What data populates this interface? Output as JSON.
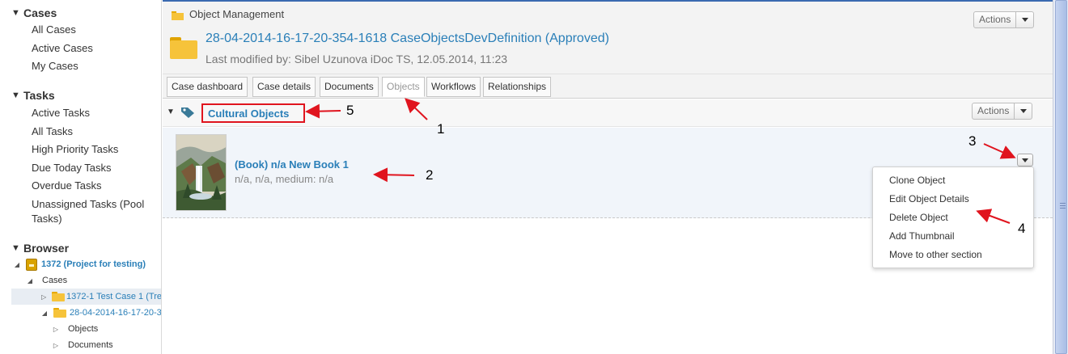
{
  "sidebar": {
    "cases": {
      "title": "Cases",
      "items": [
        "All Cases",
        "Active Cases",
        "My Cases"
      ]
    },
    "tasks": {
      "title": "Tasks",
      "items": [
        "Active Tasks",
        "All Tasks",
        "High Priority Tasks",
        "Due Today Tasks",
        "Overdue Tasks",
        "Unassigned Tasks (Pool Tasks)"
      ]
    },
    "browser": {
      "title": "Browser",
      "project": "1372 (Project for testing)",
      "cases_label": "Cases",
      "case1": "1372-1 Test Case 1 (Tre",
      "case2": "28-04-2014-16-17-20-3",
      "objects": "Objects",
      "documents": "Documents"
    }
  },
  "header": {
    "module": "Object Management",
    "title": "28-04-2014-16-17-20-354-1618 CaseObjectsDevDefinition (Approved)",
    "meta": "Last modified by: Sibel Uzunova iDoc TS, 12.05.2014, 11:23",
    "actions_label": "Actions"
  },
  "tabs": [
    "Case dashboard",
    "Case details",
    "Documents",
    "Objects",
    "Workflows",
    "Relationships"
  ],
  "active_tab": "Objects",
  "section": {
    "title": "Cultural Objects",
    "actions_label": "Actions"
  },
  "object": {
    "title": "(Book) n/a New Book 1",
    "meta": "n/a, n/a, medium: n/a"
  },
  "menu": [
    "Clone Object",
    "Edit Object Details",
    "Delete Object",
    "Add Thumbnail",
    "Move to other section"
  ],
  "annotations": [
    "1",
    "2",
    "3",
    "4",
    "5"
  ],
  "colors": {
    "link": "#2a7fb8",
    "annotation": "#e0141e",
    "folder": "#f6c33a"
  },
  "icons": [
    "folder-icon",
    "tag-icon",
    "chevron-down-icon",
    "collapse-triangle-icon"
  ]
}
